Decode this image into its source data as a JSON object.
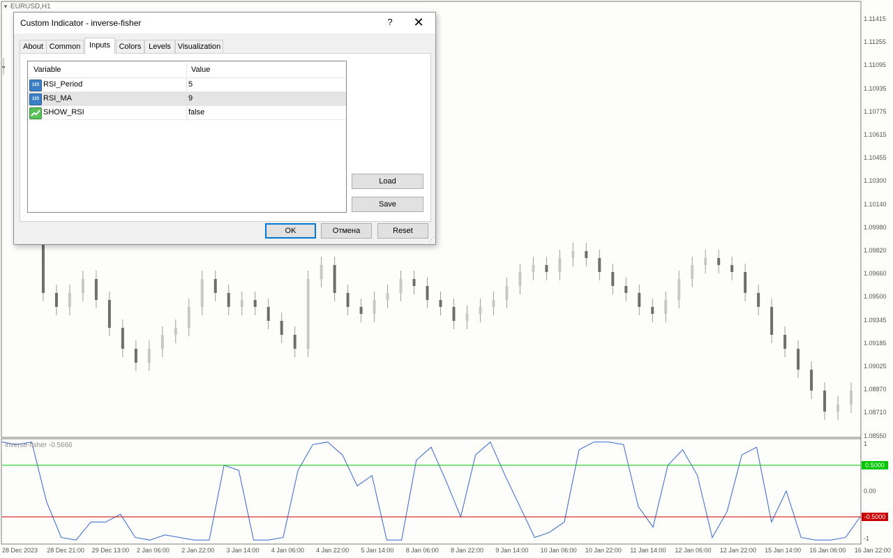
{
  "chart": {
    "symbol_title": "EURUSD,H1",
    "indicator_label": "inverse-fisher -0.5666",
    "price_axis": [
      "1.11415",
      "1.11255",
      "1.11095",
      "1.10935",
      "1.10775",
      "1.10615",
      "1.10455",
      "1.10300",
      "1.10140",
      "1.09980",
      "1.09820",
      "1.09660",
      "1.09500",
      "1.09345",
      "1.09185",
      "1.09025",
      "1.08870",
      "1.08710",
      "1.08550"
    ],
    "indicator_axis": [
      "1",
      "0.00",
      "-1"
    ],
    "levels": [
      {
        "label": "0.5000",
        "value": 0.5,
        "color": "#00c800"
      },
      {
        "label": "-0.5000",
        "value": -0.5,
        "color": "#cc0000"
      }
    ],
    "time_axis": [
      "28 Dec 2023",
      "28 Dec 21:00",
      "29 Dec 13:00",
      "2 Jan 06:00",
      "2 Jan 22:00",
      "3 Jan 14:00",
      "4 Jan 06:00",
      "4 Jan 22:00",
      "5 Jan 14:00",
      "8 Jan 06:00",
      "8 Jan 22:00",
      "9 Jan 14:00",
      "10 Jan 06:00",
      "10 Jan 22:00",
      "11 Jan 14:00",
      "12 Jan 06:00",
      "12 Jan 22:00",
      "15 Jan 14:00",
      "16 Jan 06:00",
      "16 Jan 22:00"
    ],
    "colors": {
      "candle": "#808080",
      "indicator_line": "#3366cc",
      "background": "#fdfdfb"
    }
  },
  "dialog": {
    "title": "Custom Indicator - inverse-fisher",
    "help": "?",
    "close": "✕",
    "tabs": [
      "About",
      "Common",
      "Inputs",
      "Colors",
      "Levels",
      "Visualization"
    ],
    "active_tab": "Inputs",
    "table": {
      "headers": {
        "variable": "Variable",
        "value": "Value"
      },
      "rows": [
        {
          "name": "RSI_Period",
          "value": "5",
          "type": "int",
          "icon": "123"
        },
        {
          "name": "RSI_MA",
          "value": "9",
          "type": "int",
          "icon": "123"
        },
        {
          "name": "SHOW_RSI",
          "value": "false",
          "type": "bool",
          "icon": "bool-icon"
        }
      ]
    },
    "buttons": {
      "load": "Load",
      "save": "Save",
      "ok": "OK",
      "cancel": "Отмена",
      "reset": "Reset"
    }
  }
}
